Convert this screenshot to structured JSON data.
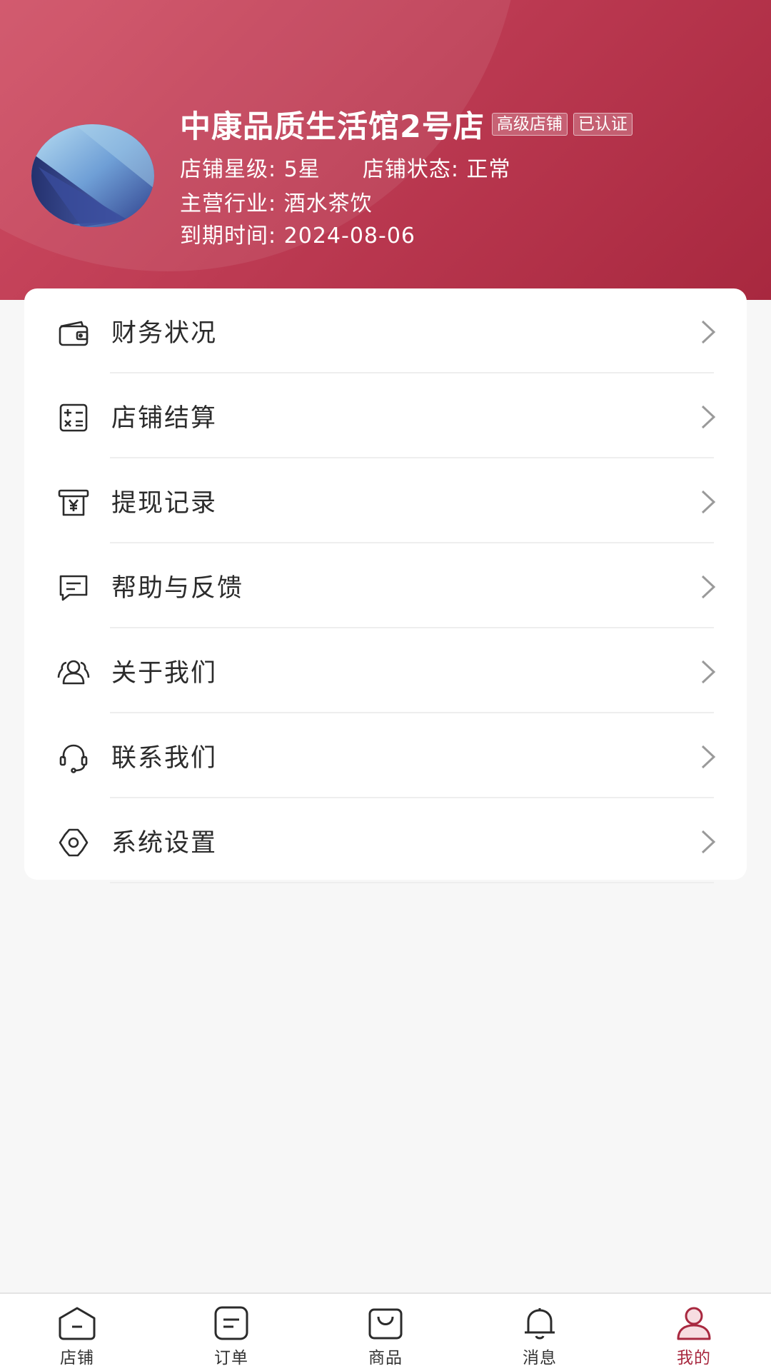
{
  "store": {
    "name": "中康品质生活馆2号店",
    "tags": [
      "高级店铺",
      "已认证"
    ],
    "rating_label": "店铺星级:",
    "rating_value": "5星",
    "status_label": "店铺状态:",
    "status_value": "正常",
    "industry_label": "主营行业:",
    "industry_value": "酒水茶饮",
    "expire_label": "到期时间:",
    "expire_value": "2024-08-06"
  },
  "menu": [
    {
      "label": "财务状况",
      "icon": "wallet-icon"
    },
    {
      "label": "店铺结算",
      "icon": "calculator-icon"
    },
    {
      "label": "提现记录",
      "icon": "withdraw-yuan-icon"
    },
    {
      "label": "帮助与反馈",
      "icon": "message-icon"
    },
    {
      "label": "关于我们",
      "icon": "users-icon"
    },
    {
      "label": "联系我们",
      "icon": "headset-icon"
    },
    {
      "label": "系统设置",
      "icon": "gear-icon"
    }
  ],
  "tabbar": [
    {
      "label": "店铺",
      "icon": "home-icon"
    },
    {
      "label": "订单",
      "icon": "order-icon"
    },
    {
      "label": "商品",
      "icon": "bag-icon"
    },
    {
      "label": "消息",
      "icon": "bell-icon"
    },
    {
      "label": "我的",
      "icon": "user-icon",
      "active": true
    }
  ],
  "colors": {
    "brand": "#bd3b53",
    "brand_dark": "#a8283f",
    "text": "#2b2b2b",
    "background": "#f7f7f7"
  }
}
